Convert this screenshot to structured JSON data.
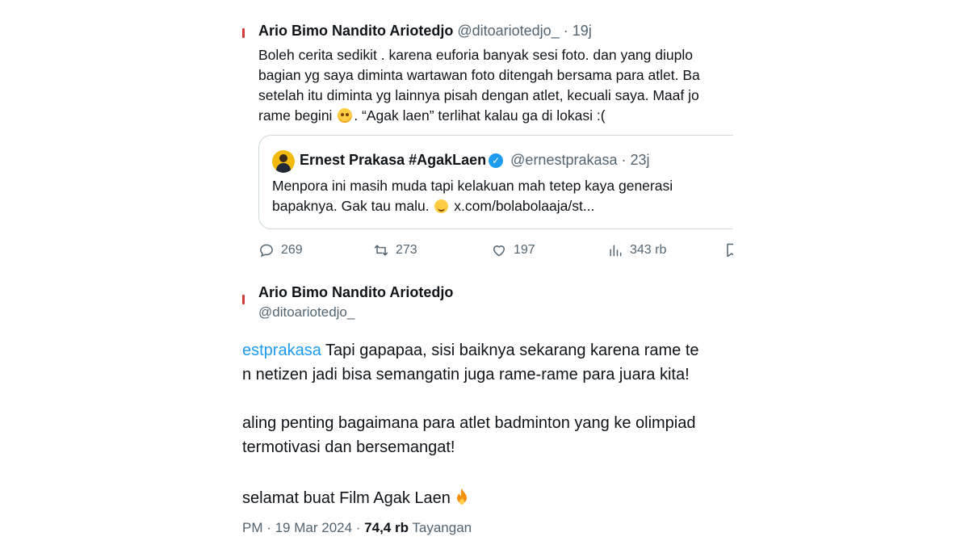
{
  "tweet1": {
    "author_name": "Ario Bimo Nandito Ariotedjo",
    "author_handle": "@ditoariotedjo_",
    "sep": " · ",
    "time": "19j",
    "lines": [
      "Boleh cerita sedikit . karena euforia banyak sesi foto. dan yang  diuplo",
      "bagian yg saya diminta wartawan foto ditengah bersama  para atlet. Ba",
      "setelah itu diminta yg lainnya pisah dengan atlet, kecuali saya. Maaf  jo"
    ],
    "last_line_pre": "rame begini ",
    "last_line_post": ". “Agak laen” terlihat kalau ga di lokasi  :(",
    "quote": {
      "name": "Ernest Prakasa #AgakLaen",
      "verified_mark": "✓",
      "handle": "@ernestprakasa",
      "sep": " · ",
      "time": "23j",
      "line1": "Menpora ini masih muda tapi kelakuan mah tetep kaya generasi",
      "line2_pre": "bapaknya. Gak tau malu. ",
      "line2_post": " x.com/bolabolaaja/st..."
    },
    "stats": {
      "replies": "269",
      "reposts": "273",
      "likes": "197",
      "views": "343 rb"
    },
    "icons": [
      "reply-icon",
      "repost-icon",
      "like-icon",
      "views-icon",
      "bookmark-icon"
    ]
  },
  "tweet2": {
    "author_name": "Ario Bimo Nandito Ariotedjo",
    "author_handle": "@ditoariotedjo_",
    "mention": "estprakasa",
    "line1_rest": " Tapi gapapaa, sisi baiknya sekarang karena rame te",
    "line2": "n netizen jadi bisa semangatin juga rame-rame para juara kita!",
    "line3": "aling penting bagaimana para atlet badminton yang ke olimpiad",
    "line4": " termotivasi dan bersemangat!",
    "line5": "selamat buat Film Agak Laen",
    "footer_time": "PM · 19 Mar 2024 · ",
    "footer_views": "74,4 rb",
    "footer_views_label": " Tayangan"
  },
  "colors": {
    "text": "#0f1419",
    "muted": "#536471",
    "link": "#1d9bf0",
    "border": "#cfd9de"
  }
}
